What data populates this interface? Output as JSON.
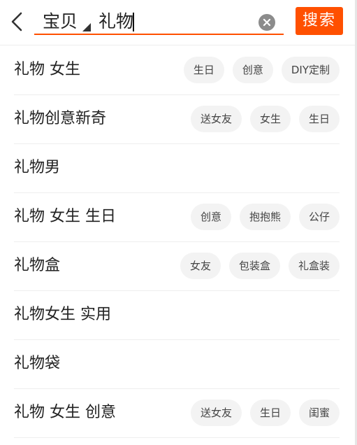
{
  "search": {
    "scope_label": "宝贝",
    "query": "礼物",
    "button_label": "搜索"
  },
  "suggestions": [
    {
      "title": "礼物 女生",
      "tags": [
        "生日",
        "创意",
        "DIY定制"
      ]
    },
    {
      "title": "礼物创意新奇",
      "tags": [
        "送女友",
        "女生",
        "生日"
      ]
    },
    {
      "title": "礼物男",
      "tags": []
    },
    {
      "title": "礼物 女生 生日",
      "tags": [
        "创意",
        "抱抱熊",
        "公仔"
      ]
    },
    {
      "title": "礼物盒",
      "tags": [
        "女友",
        "包装盒",
        "礼盒装"
      ]
    },
    {
      "title": "礼物女生 实用",
      "tags": []
    },
    {
      "title": "礼物袋",
      "tags": []
    },
    {
      "title": "礼物 女生 创意",
      "tags": [
        "送女友",
        "生日",
        "闺蜜"
      ]
    }
  ],
  "colors": {
    "accent": "#ff5000"
  }
}
